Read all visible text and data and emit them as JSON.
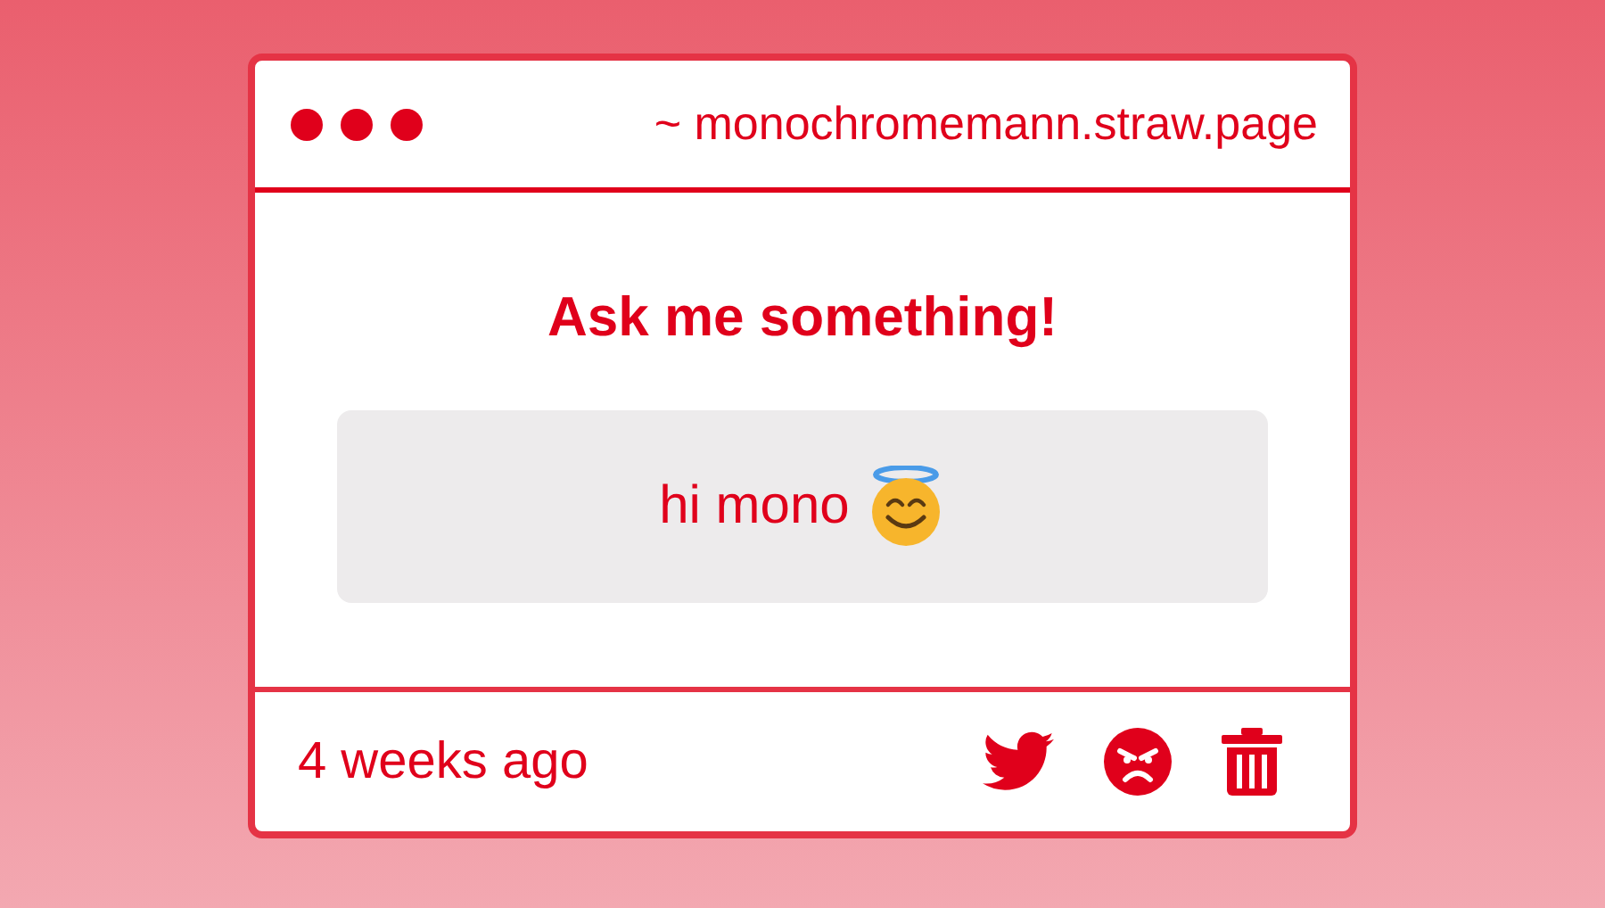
{
  "window": {
    "url": "~ monochromemann.straw.page"
  },
  "card": {
    "heading": "Ask me something!",
    "message": "hi mono"
  },
  "footer": {
    "time": "4 weeks ago"
  }
}
